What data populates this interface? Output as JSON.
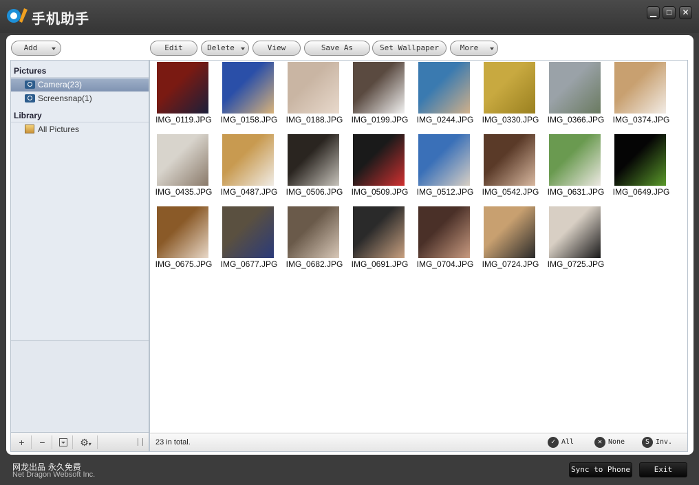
{
  "app": {
    "title": "手机助手"
  },
  "toolbar": {
    "add": "Add",
    "edit": "Edit",
    "delete": "Delete",
    "view": "View",
    "save_as": "Save As",
    "set_wallpaper": "Set Wallpaper",
    "more": "More"
  },
  "sidebar": {
    "pictures_header": "Pictures",
    "camera": "Camera(23)",
    "screensnap": "Screensnap(1)",
    "library_header": "Library",
    "all_pictures": "All Pictures",
    "footer": {
      "add": "+",
      "remove": "−",
      "gear": "⚙"
    }
  },
  "colors": {
    "background": "#3c3c3c",
    "selection": "#8a9cb9",
    "panel": "#ffffff"
  },
  "thumbnails": [
    {
      "name": "IMG_0119.JPG",
      "c1": "#7a1a12",
      "c2": "#1b1f3a"
    },
    {
      "name": "IMG_0158.JPG",
      "c1": "#2a4fa8",
      "c2": "#d9b37a"
    },
    {
      "name": "IMG_0188.JPG",
      "c1": "#c9b5a3",
      "c2": "#e8d9cc"
    },
    {
      "name": "IMG_0199.JPG",
      "c1": "#5a4a40",
      "c2": "#f2f2f2"
    },
    {
      "name": "IMG_0244.JPG",
      "c1": "#3a7ab0",
      "c2": "#d0b08a"
    },
    {
      "name": "IMG_0330.JPG",
      "c1": "#c8a940",
      "c2": "#9a8020"
    },
    {
      "name": "IMG_0366.JPG",
      "c1": "#9aa2a8",
      "c2": "#6a7a60"
    },
    {
      "name": "IMG_0374.JPG",
      "c1": "#c8a070",
      "c2": "#f2ece6"
    },
    {
      "name": "IMG_0435.JPG",
      "c1": "#d8d4cc",
      "c2": "#8a7a6a"
    },
    {
      "name": "IMG_0487.JPG",
      "c1": "#c89a50",
      "c2": "#f0ece6"
    },
    {
      "name": "IMG_0506.JPG",
      "c1": "#2a2520",
      "c2": "#c8c4bc"
    },
    {
      "name": "IMG_0509.JPG",
      "c1": "#1a1a1a",
      "c2": "#d03030"
    },
    {
      "name": "IMG_0512.JPG",
      "c1": "#3a70b8",
      "c2": "#d8cfc4"
    },
    {
      "name": "IMG_0542.JPG",
      "c1": "#5a3a28",
      "c2": "#d8b8a0"
    },
    {
      "name": "IMG_0631.JPG",
      "c1": "#6a9a50",
      "c2": "#ece8e2"
    },
    {
      "name": "IMG_0649.JPG",
      "c1": "#050505",
      "c2": "#5a9a2a"
    },
    {
      "name": "IMG_0675.JPG",
      "c1": "#8a5a28",
      "c2": "#e8d8c8"
    },
    {
      "name": "IMG_0677.JPG",
      "c1": "#5a5040",
      "c2": "#2a3a7a"
    },
    {
      "name": "IMG_0682.JPG",
      "c1": "#6a5a4a",
      "c2": "#d8c8b8"
    },
    {
      "name": "IMG_0691.JPG",
      "c1": "#2a2a2a",
      "c2": "#c8a080"
    },
    {
      "name": "IMG_0704.JPG",
      "c1": "#4a3028",
      "c2": "#c89a80"
    },
    {
      "name": "IMG_0724.JPG",
      "c1": "#c8a070",
      "c2": "#2a2a2a"
    },
    {
      "name": "IMG_0725.JPG",
      "c1": "#d8cfc4",
      "c2": "#1a1a1a"
    }
  ],
  "status": {
    "count": "23 in total.",
    "all": "All",
    "all_icon": "✓",
    "none": "None",
    "none_icon": "✕",
    "inv": "Inv.",
    "inv_icon": "S"
  },
  "footer": {
    "cn": "网龙出品 永久免费",
    "en": "Net Dragon Websoft Inc.",
    "sync": "Sync to Phone",
    "exit": "Exit"
  }
}
